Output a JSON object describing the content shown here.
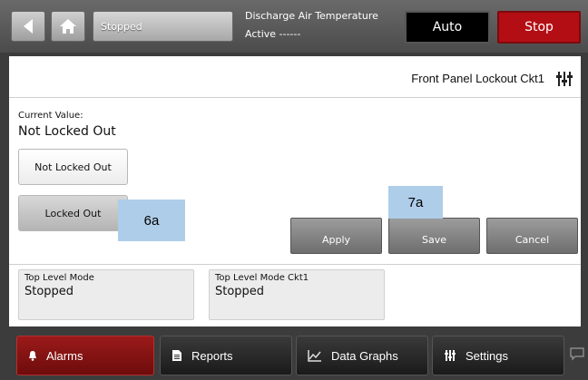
{
  "header": {
    "status": "Stopped",
    "point_name": "Discharge Air Temperature",
    "point_status": "Active ------",
    "auto_label": "Auto",
    "stop_label": "Stop"
  },
  "panel": {
    "title": "Front Panel Lockout Ckt1",
    "current_value_label": "Current Value:",
    "current_value": "Not Locked Out",
    "options": [
      "Not Locked Out",
      "Locked Out"
    ],
    "apply_label": "Apply",
    "save_label": "Save",
    "cancel_label": "Cancel"
  },
  "callouts": {
    "step_6a": "6a",
    "step_7a": "7a"
  },
  "modes": [
    {
      "label": "Top Level Mode",
      "value": "Stopped"
    },
    {
      "label": "Top Level Mode Ckt1",
      "value": "Stopped"
    }
  ],
  "tabs": {
    "alarms": "Alarms",
    "reports": "Reports",
    "data_graphs": "Data Graphs",
    "settings": "Settings"
  },
  "colors": {
    "stop_red": "#b30e14",
    "alarms_red": "#8a1414",
    "callout_blue": "#aecde9"
  },
  "icons": [
    "back-arrow-icon",
    "home-icon",
    "settings-sliders-icon",
    "bell-icon",
    "report-icon",
    "chart-icon",
    "chat-icon"
  ]
}
